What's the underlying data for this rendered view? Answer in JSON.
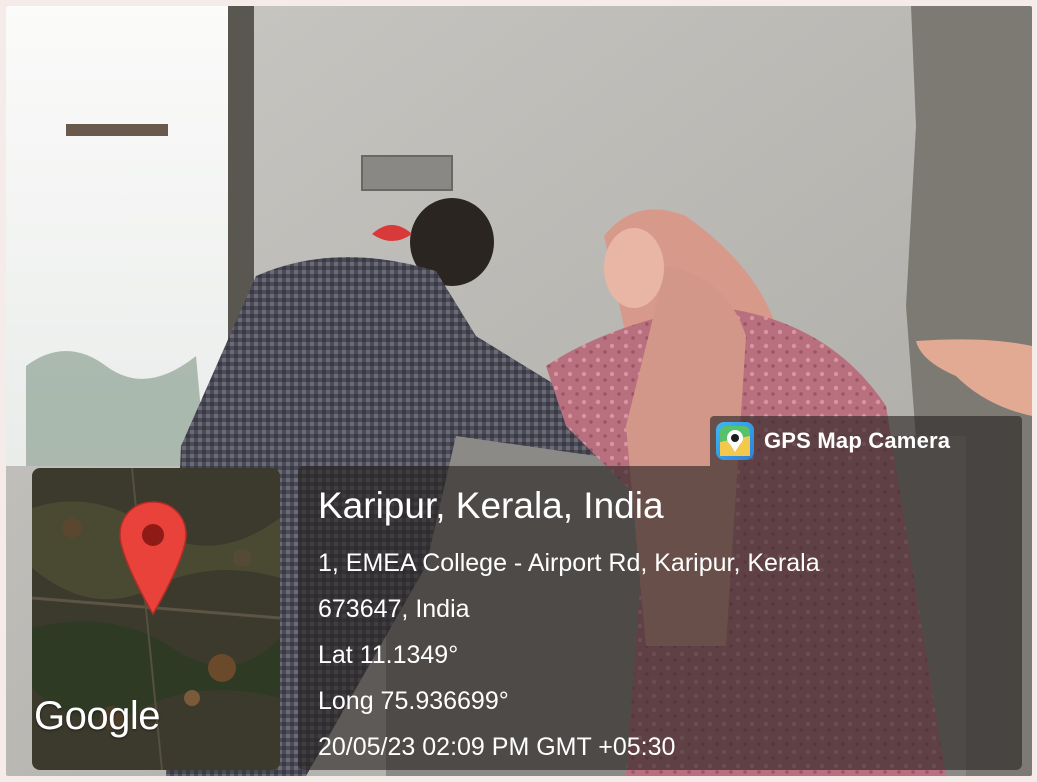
{
  "badge": {
    "label": "GPS Map Camera",
    "icon": "gps-map-camera-app-icon"
  },
  "location": {
    "title": "Karipur, Kerala, India",
    "address_line1": "1, EMEA College - Airport Rd, Karipur, Kerala",
    "address_line2": "673647, India",
    "latitude": "Lat 11.1349°",
    "longitude": "Long 75.936699°",
    "datetime": "20/05/23 02:09 PM GMT +05:30"
  },
  "map": {
    "logo_text": "Google",
    "pin_icon": "map-pin-icon",
    "pin_color": "#e8423a"
  },
  "colors": {
    "overlay": "#282422",
    "wall": "#b9b7b3",
    "dress_pink": "#c97a86",
    "scarf_peach": "#d89b8c",
    "shirt_check": "#4a4a56"
  }
}
